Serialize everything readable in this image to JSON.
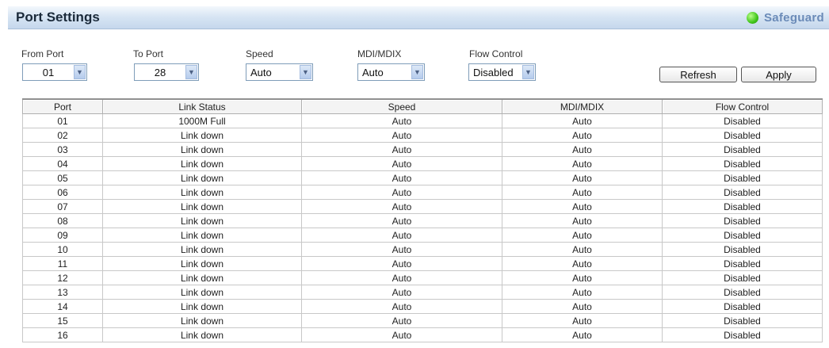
{
  "header": {
    "title": "Port Settings",
    "safeguard_label": "Safeguard"
  },
  "controls": {
    "from_port": {
      "label": "From Port",
      "value": "01"
    },
    "to_port": {
      "label": "To Port",
      "value": "28"
    },
    "speed": {
      "label": "Speed",
      "value": "Auto"
    },
    "mdi": {
      "label": "MDI/MDIX",
      "value": "Auto"
    },
    "flow_control": {
      "label": "Flow Control",
      "value": "Disabled"
    },
    "refresh_label": "Refresh",
    "apply_label": "Apply"
  },
  "table": {
    "columns": [
      "Port",
      "Link Status",
      "Speed",
      "MDI/MDIX",
      "Flow Control"
    ],
    "rows": [
      [
        "01",
        "1000M Full",
        "Auto",
        "Auto",
        "Disabled"
      ],
      [
        "02",
        "Link down",
        "Auto",
        "Auto",
        "Disabled"
      ],
      [
        "03",
        "Link down",
        "Auto",
        "Auto",
        "Disabled"
      ],
      [
        "04",
        "Link down",
        "Auto",
        "Auto",
        "Disabled"
      ],
      [
        "05",
        "Link down",
        "Auto",
        "Auto",
        "Disabled"
      ],
      [
        "06",
        "Link down",
        "Auto",
        "Auto",
        "Disabled"
      ],
      [
        "07",
        "Link down",
        "Auto",
        "Auto",
        "Disabled"
      ],
      [
        "08",
        "Link down",
        "Auto",
        "Auto",
        "Disabled"
      ],
      [
        "09",
        "Link down",
        "Auto",
        "Auto",
        "Disabled"
      ],
      [
        "10",
        "Link down",
        "Auto",
        "Auto",
        "Disabled"
      ],
      [
        "11",
        "Link down",
        "Auto",
        "Auto",
        "Disabled"
      ],
      [
        "12",
        "Link down",
        "Auto",
        "Auto",
        "Disabled"
      ],
      [
        "13",
        "Link down",
        "Auto",
        "Auto",
        "Disabled"
      ],
      [
        "14",
        "Link down",
        "Auto",
        "Auto",
        "Disabled"
      ],
      [
        "15",
        "Link down",
        "Auto",
        "Auto",
        "Disabled"
      ],
      [
        "16",
        "Link down",
        "Auto",
        "Auto",
        "Disabled"
      ]
    ]
  },
  "colors": {
    "title_bar": "#d6e4f3",
    "safeguard_text": "#6b8bb8",
    "safeguard_indicator": "#3fc41a"
  },
  "icons": {
    "safeguard_status": "green-dot-icon",
    "select_arrow": "chevron-down-icon"
  }
}
